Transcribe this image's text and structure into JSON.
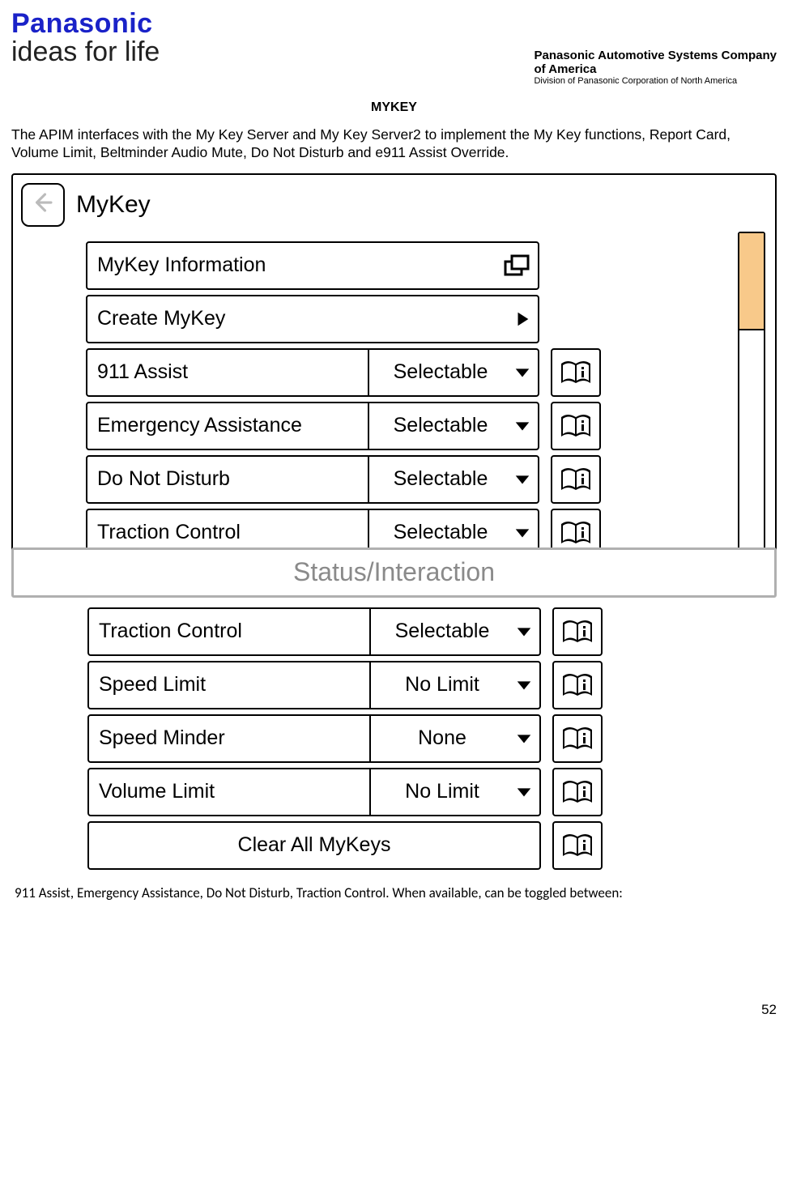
{
  "brand": {
    "name": "Panasonic",
    "tagline": "ideas for life"
  },
  "company": {
    "line1": "Panasonic Automotive Systems Company",
    "line2": "of America",
    "line3": "Division of Panasonic Corporation of North America"
  },
  "section_title": "MYKEY",
  "intro_para": "The APIM interfaces with the My Key Server and My Key Server2 to implement the My Key functions, Report Card, Volume Limit, Beltminder Audio Mute, Do Not Disturb and e911 Assist Override.",
  "screen_title": "MyKey",
  "rows_top": [
    {
      "label": "MyKey Information",
      "right": "popup",
      "info": false
    },
    {
      "label": "Create MyKey",
      "right": "arrow",
      "info": false
    },
    {
      "label": "911 Assist",
      "value": "Selectable",
      "info": true
    },
    {
      "label": "Emergency Assistance",
      "value": "Selectable",
      "info": true
    },
    {
      "label": "Do Not Disturb",
      "value": "Selectable",
      "info": true
    },
    {
      "label": "Traction Control",
      "value": "Selectable",
      "info": true
    }
  ],
  "status_bar": "Status/Interaction",
  "rows_bottom": [
    {
      "label": "Traction Control",
      "value": "Selectable",
      "info": true
    },
    {
      "label": "Speed Limit",
      "value": "No Limit",
      "info": true
    },
    {
      "label": "Speed Minder",
      "value": "None",
      "info": true
    },
    {
      "label": "Volume Limit",
      "value": "No Limit",
      "info": true
    },
    {
      "label": "Clear All MyKeys",
      "clear": true,
      "info": true
    }
  ],
  "footer_para": "911 Assist, Emergency Assistance, Do Not Disturb, Traction Control.  When available, can be toggled between:",
  "page_number": "52"
}
